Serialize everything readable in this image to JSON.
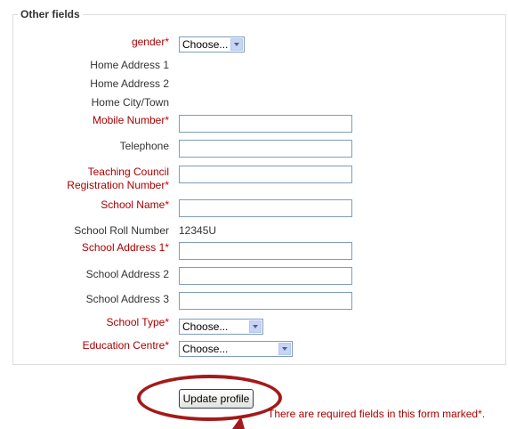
{
  "legend": "Other fields",
  "fields": {
    "gender": {
      "label": "gender",
      "required_mark": "*",
      "selected": "Choose..."
    },
    "home_address_1": {
      "label": "Home Address 1"
    },
    "home_address_2": {
      "label": "Home Address 2"
    },
    "home_city": {
      "label": "Home City/Town"
    },
    "mobile_number": {
      "label": "Mobile Number",
      "required_mark": "*",
      "value": ""
    },
    "telephone": {
      "label": "Telephone",
      "value": ""
    },
    "teaching_council": {
      "label_line1": "Teaching Council",
      "label_line2": "Registration Number",
      "required_mark": "*",
      "value": ""
    },
    "school_name": {
      "label": "School Name",
      "required_mark": "*",
      "value": ""
    },
    "school_roll_number": {
      "label": "School Roll Number",
      "value": "12345U"
    },
    "school_address_1": {
      "label": "School Address 1",
      "required_mark": "*",
      "value": ""
    },
    "school_address_2": {
      "label": "School Address 2",
      "value": ""
    },
    "school_address_3": {
      "label": "School Address 3",
      "value": ""
    },
    "school_type": {
      "label": "School Type",
      "required_mark": "*",
      "selected": "Choose..."
    },
    "education_centre": {
      "label": "Education Centre",
      "required_mark": "*",
      "selected": "Choose..."
    }
  },
  "update_button": "Update profile",
  "required_note": "There are required fields in this form marked",
  "required_note_mark": "*.",
  "colors": {
    "required": "#aa0000",
    "annotation": "#a31a1a",
    "input_border": "#7f9db9"
  }
}
